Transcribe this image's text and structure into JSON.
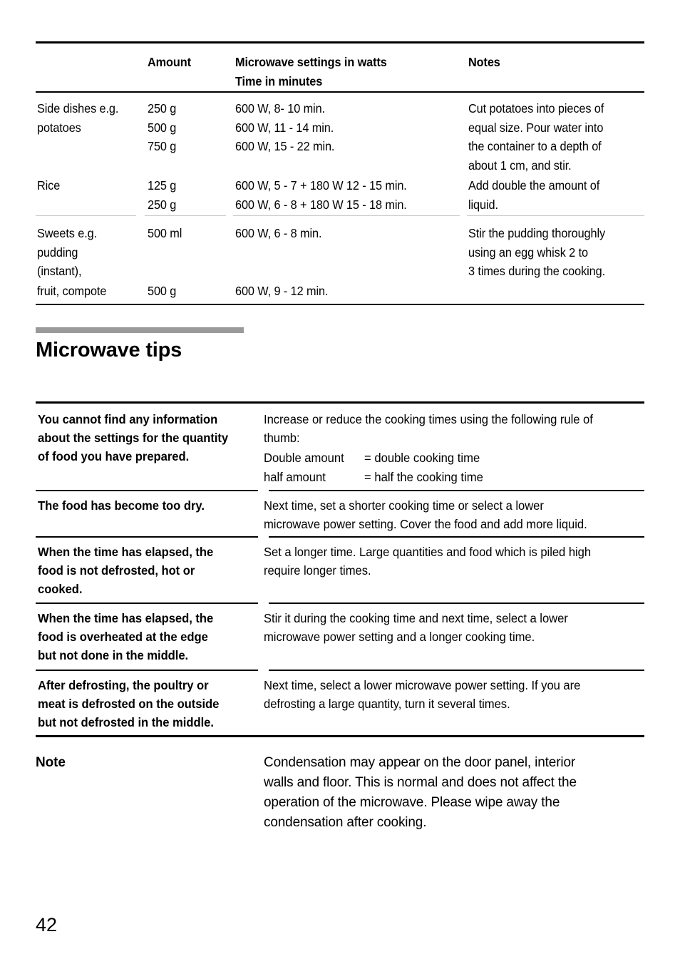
{
  "page": {
    "number": "42"
  },
  "settings_table": {
    "headers": {
      "food": "",
      "amount": "Amount",
      "settings": "Microwave settings in watts\nTime in minutes",
      "notes": "Notes"
    },
    "rows": [
      {
        "food": "Side dishes e.g.\npotatoes",
        "amount": "250 g\n500 g\n750 g",
        "settings": "600 W, 8- 10 min.\n600 W, 11 - 14 min.\n600 W, 15 - 22 min.",
        "notes": "Cut potatoes into pieces of\nequal size. Pour water into\nthe container to a depth of\nabout 1 cm, and stir."
      },
      {
        "food": "Rice",
        "amount": "125 g\n250 g",
        "settings": "600 W, 5 - 7 + 180 W 12 - 15 min.\n600 W, 6 - 8 + 180 W 15 - 18 min.",
        "notes": "Add double the amount of\nliquid."
      },
      {
        "food": "Sweets e.g.\npudding\n(instant),",
        "amount": "500 ml",
        "settings": "600 W, 6 - 8 min.",
        "notes": "Stir the pudding thoroughly\nusing an egg whisk 2 to\n3 times during the cooking."
      },
      {
        "food": "fruit, compote",
        "amount": "500 g",
        "settings": "600 W, 9 - 12 min.",
        "notes": ""
      }
    ]
  },
  "section": {
    "title": "Microwave tips",
    "bar_color": "#9a9a9a"
  },
  "tips_table": {
    "rows": [
      {
        "question": "You cannot find any information\nabout the settings for the quantity\nof food you have prepared.",
        "answer": "Increase or reduce the cooking times using the following rule of\nthumb:",
        "rule_of_thumb": [
          {
            "label": "Double amount",
            "value": "= double cooking time"
          },
          {
            "label": "half amount",
            "value": "= half the cooking time"
          }
        ]
      },
      {
        "question": "The food has become too dry.",
        "answer": "Next time, set a shorter cooking time or select a lower\nmicrowave power setting. Cover the food and add more liquid."
      },
      {
        "question": "When the time has elapsed, the\nfood is not defrosted, hot or\ncooked.",
        "answer": "Set a longer time. Large quantities and food which is piled high\nrequire longer times."
      },
      {
        "question": "When the time has elapsed, the\nfood is overheated at the edge\nbut not done in the middle.",
        "answer": "Stir it during the cooking time and next time, select a lower\nmicrowave power setting and a longer cooking time."
      },
      {
        "question": "After defrosting, the poultry or\nmeat is defrosted on the outside\nbut not defrosted in the middle.",
        "answer": "Next time, select a lower microwave power setting. If you are\ndefrosting a large quantity, turn it several times."
      }
    ]
  },
  "note": {
    "label": "Note",
    "text": "Condensation may appear on the door panel, interior\nwalls and floor. This is normal and does not affect the\noperation of the microwave. Please wipe away the\ncondensation after cooking."
  }
}
